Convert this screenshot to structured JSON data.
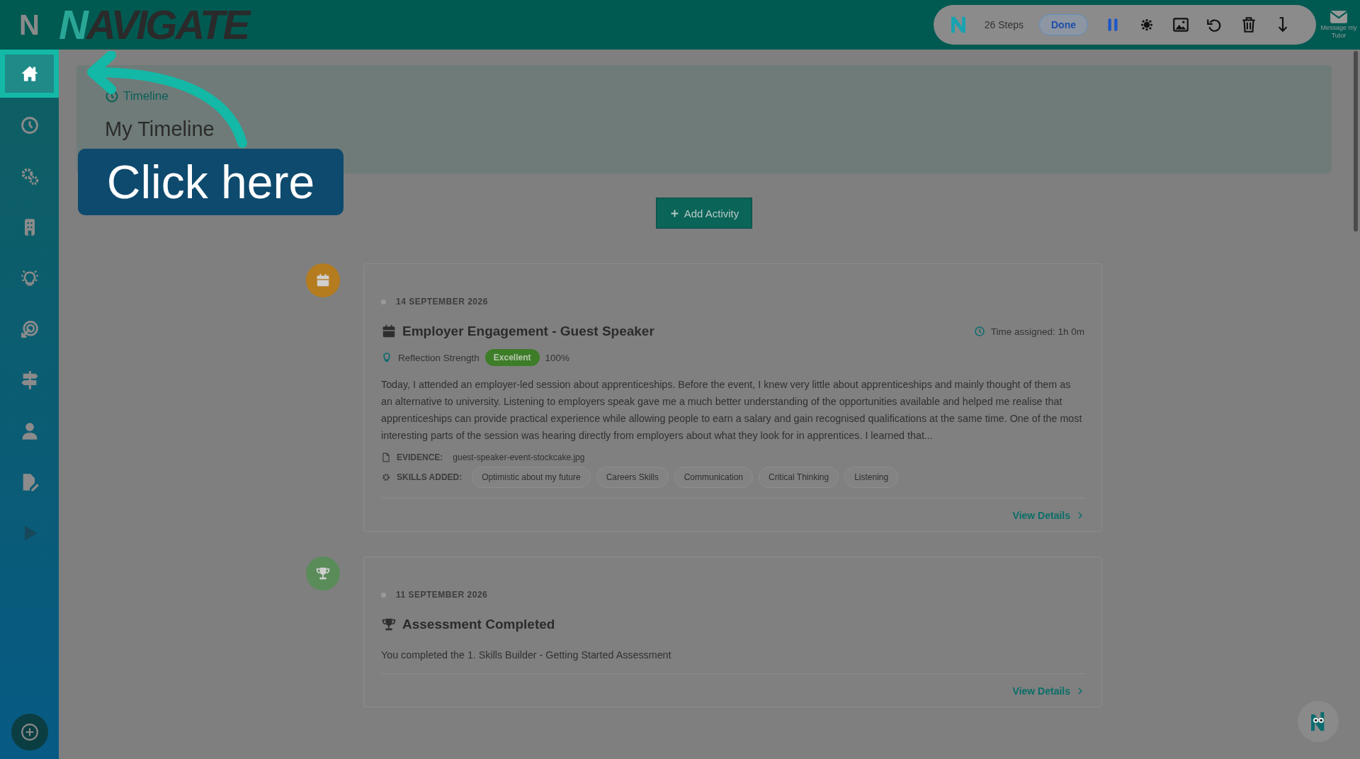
{
  "app": {
    "logo": "N",
    "brand": {
      "initial": "N",
      "rest": "AVIGATE"
    }
  },
  "recorder": {
    "steps": "26 Steps",
    "done": "Done",
    "tools": [
      {
        "kind": "pause"
      },
      {
        "kind": "blur"
      },
      {
        "kind": "image"
      },
      {
        "kind": "undo"
      },
      {
        "kind": "delete"
      },
      {
        "kind": "download"
      }
    ]
  },
  "message": {
    "label": "Message my Tutor"
  },
  "sidebar": {
    "items": [
      {
        "kind": "home",
        "selected": true
      },
      {
        "kind": "clock",
        "selected": false
      },
      {
        "kind": "gears",
        "selected": false
      },
      {
        "kind": "building",
        "selected": false
      },
      {
        "kind": "bulb",
        "selected": false
      },
      {
        "kind": "target",
        "selected": false
      },
      {
        "kind": "signpost",
        "selected": false
      },
      {
        "kind": "person",
        "selected": false
      },
      {
        "kind": "file-edit",
        "selected": false
      },
      {
        "kind": "play",
        "selected": false
      }
    ]
  },
  "header": {
    "breadcrumb": "Timeline",
    "title": "My Timeline"
  },
  "callout": {
    "text": "Click here"
  },
  "add_button": {
    "label": "Add Activity"
  },
  "entries": [
    {
      "kind": "event",
      "color": "#b47c1e",
      "date": "14 SEPTEMBER 2026",
      "title": "Employer Engagement - Guest Speaker",
      "time_assigned": "Time assigned: 1h 0m",
      "reflection_label": "Reflection Strength",
      "strength": "Excellent",
      "percent": "100%",
      "body": "Today, I attended an employer-led session about apprenticeships. Before the event, I knew very little about apprenticeships and mainly thought of them as an alternative to university. Listening to employers speak gave me a much better understanding of the opportunities available and helped me realise that apprenticeships can provide practical experience while allowing people to earn a salary and gain recognised qualifications at the same time. One of the most interesting parts of the session was hearing directly from employers about what they look for in apprentices. I learned that...",
      "evidence_label": "EVIDENCE:",
      "evidence": "guest-speaker-event-stockcake.jpg",
      "skills_label": "SKILLS ADDED:",
      "skills": [
        "Optimistic about my future",
        "Careers Skills",
        "Communication",
        "Critical Thinking",
        "Listening"
      ],
      "link": "View Details"
    },
    {
      "kind": "assessment",
      "color": "#5a8c5a",
      "date": "11 SEPTEMBER 2026",
      "title": "Assessment Completed",
      "body": "You completed the 1. Skills Builder - Getting Started Assessment",
      "link": "View Details"
    }
  ]
}
